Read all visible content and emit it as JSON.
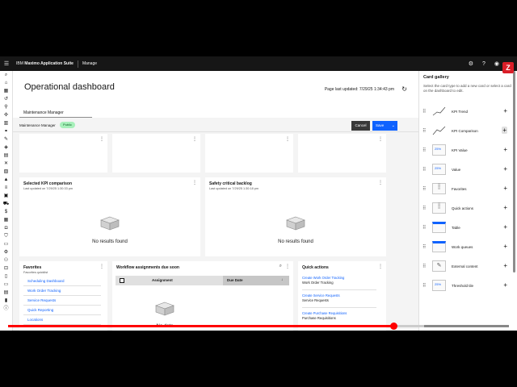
{
  "topbar": {
    "menu_icon": "menu-icon",
    "brand_prefix": "IBM ",
    "brand_name": "Maximo Application Suite",
    "module": "Manage",
    "logo_letter": "Z"
  },
  "header": {
    "title": "Operational dashboard",
    "updated_label": "Page last updated: 7/29/25 1:34:43 pm",
    "tab": "Maintenance Manager"
  },
  "subbar": {
    "dashboard_name": "Maintenance Manager",
    "badge": "Public",
    "cancel": "Cancel",
    "save": "Save"
  },
  "cards": {
    "kpi_comparison": {
      "title": "Selected KPI comparison",
      "subtitle": "Last updated on 7/29/25 1:30:33 pm",
      "empty": "No results found"
    },
    "safety_backlog": {
      "title": "Safety critical backlog",
      "subtitle": "Last updated on 7/29/25 1:30:18 pm",
      "empty": "No results found"
    },
    "favorites": {
      "title": "Favorites",
      "subtitle": "Favorites quicklist",
      "items": [
        "Scheduling Dashboard",
        "Work Order Tracking",
        "Service Requests",
        "Quick Reporting",
        "Locations"
      ]
    },
    "workflow": {
      "title": "Workflow assignments due soon",
      "col_assignment": "Assignment",
      "col_due": "Due Date",
      "empty": "No data"
    },
    "quick_actions": {
      "title": "Quick actions",
      "items": [
        {
          "action": "Create Work Order Tracking",
          "app": "Work Order Tracking"
        },
        {
          "action": "Create Service Requests",
          "app": "Service Requests"
        },
        {
          "action": "Create Purchase Requisitions",
          "app": "Purchase Requisitions"
        }
      ]
    }
  },
  "gallery": {
    "title": "Card gallery",
    "description": "Select the card type to add a new card or select a card on the dashboard to edit.",
    "items": [
      "KPI Trend",
      "KPI Comparison",
      "KPI Value",
      "Value",
      "Favorites",
      "Quick actions",
      "Table",
      "Work queues",
      "External content",
      "Threshold tile"
    ],
    "thumb_values": {
      "kpi_value": "25%",
      "value": "25%",
      "threshold": "25%"
    }
  },
  "video": {
    "played_fraction": 0.77,
    "buffered_fraction": 0.83
  },
  "colors": {
    "primary": "#0f62fe",
    "topbar": "#161616",
    "badge_bg": "#a7f0ba",
    "progress": "#ff0000"
  }
}
